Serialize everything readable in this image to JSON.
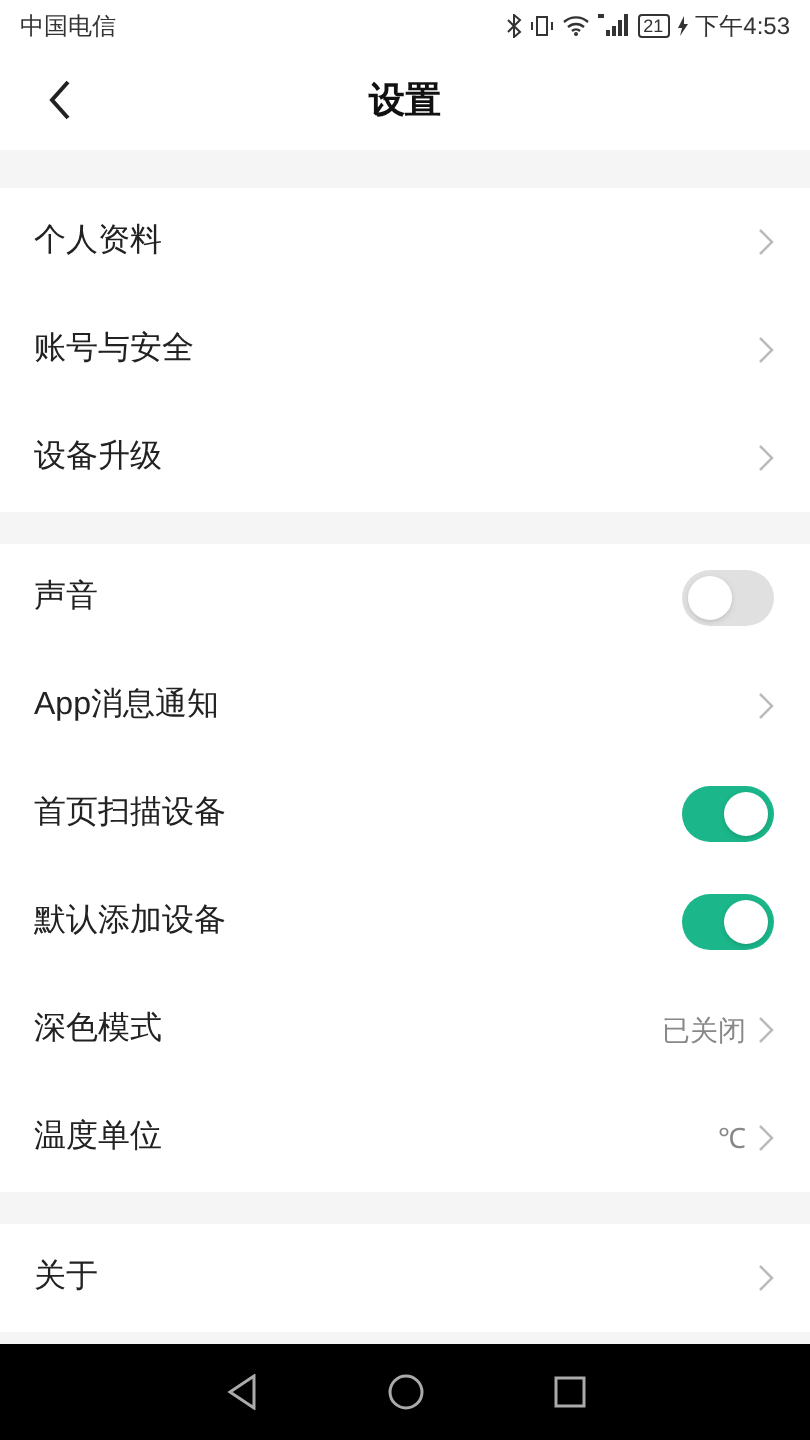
{
  "status_bar": {
    "carrier": "中国电信",
    "battery": "21",
    "time": "下午4:53"
  },
  "header": {
    "title": "设置"
  },
  "groups": [
    {
      "items": [
        {
          "kind": "link",
          "label": "个人资料"
        },
        {
          "kind": "link",
          "label": "账号与安全"
        },
        {
          "kind": "link",
          "label": "设备升级"
        }
      ]
    },
    {
      "items": [
        {
          "kind": "toggle",
          "label": "声音",
          "on": false
        },
        {
          "kind": "link",
          "label": "App消息通知"
        },
        {
          "kind": "toggle",
          "label": "首页扫描设备",
          "on": true
        },
        {
          "kind": "toggle",
          "label": "默认添加设备",
          "on": true
        },
        {
          "kind": "link",
          "label": "深色模式",
          "value": "已关闭"
        },
        {
          "kind": "link",
          "label": "温度单位",
          "value": "℃"
        }
      ]
    },
    {
      "items": [
        {
          "kind": "link",
          "label": "关于"
        }
      ]
    }
  ]
}
